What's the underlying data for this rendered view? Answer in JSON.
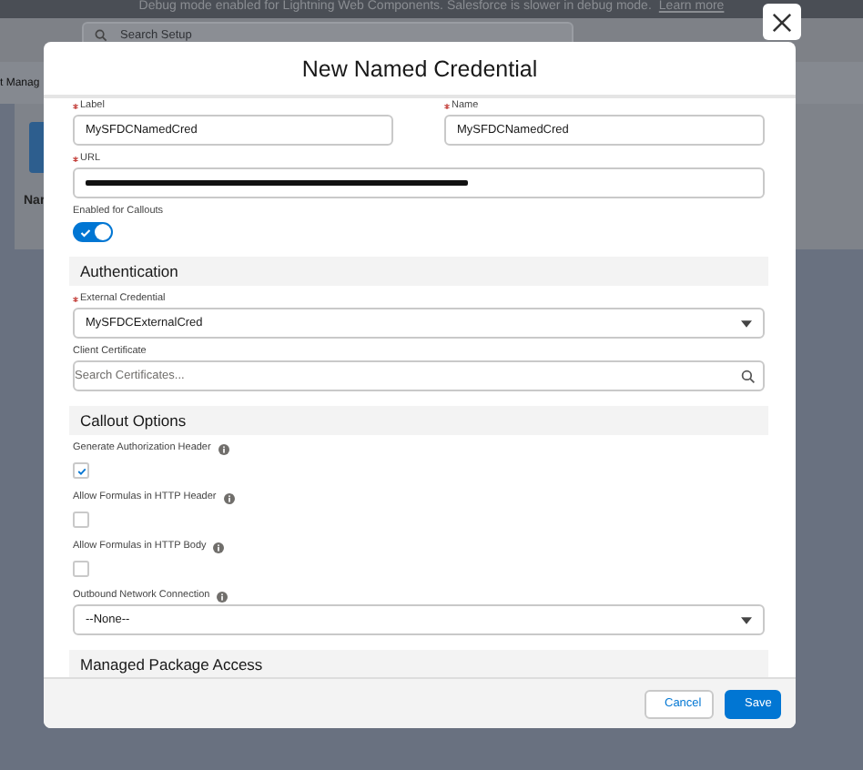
{
  "background": {
    "banner": {
      "text": "Debug mode enabled for Lightning Web Components. Salesforce is slower in debug mode.",
      "link": "Learn more"
    },
    "search": {
      "placeholder": "Search Setup"
    },
    "tab_fragment": "t Manag",
    "column_fragment": "Nar"
  },
  "modal": {
    "title": "New Named Credential",
    "fields": [
      {
        "kind": "text-pair",
        "items": [
          {
            "label": "Label",
            "required": true,
            "value": "MySFDCNamedCred"
          },
          {
            "label": "Name",
            "required": true,
            "value": "MySFDCNamedCred"
          }
        ]
      },
      {
        "kind": "redacted",
        "label": "URL",
        "required": true
      },
      {
        "kind": "toggle",
        "label": "Enabled for Callouts",
        "on": true
      },
      {
        "kind": "section",
        "label": "Authentication"
      },
      {
        "kind": "select",
        "label": "External Credential",
        "required": true,
        "info": false,
        "value": "MySFDCExternalCred"
      },
      {
        "kind": "search",
        "label": "Client Certificate",
        "required": false,
        "placeholder": "Search Certificates..."
      },
      {
        "kind": "section",
        "label": "Callout Options"
      },
      {
        "kind": "checkbox",
        "label": "Generate Authorization Header",
        "checked": true
      },
      {
        "kind": "checkbox",
        "label": "Allow Formulas in HTTP Header",
        "checked": false
      },
      {
        "kind": "checkbox",
        "label": "Allow Formulas in HTTP Body",
        "checked": false
      },
      {
        "kind": "select",
        "label": "Outbound Network Connection",
        "required": false,
        "info": true,
        "value": "--None--"
      },
      {
        "kind": "section",
        "label": "Managed Package Access"
      }
    ],
    "buttons": [
      {
        "label": "Cancel",
        "kind": "neutral"
      },
      {
        "label": "Save",
        "kind": "brand"
      }
    ]
  }
}
